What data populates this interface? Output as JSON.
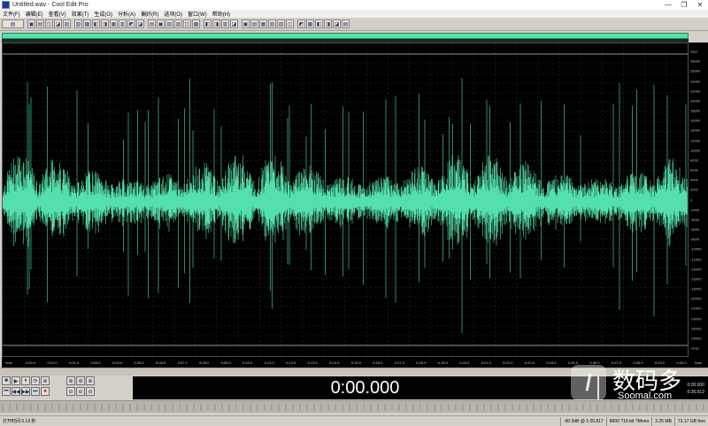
{
  "window": {
    "title": "Untitled.wav - Cool Edit Pro",
    "minimize_glyph": "—",
    "maximize_glyph": "❐",
    "close_glyph": "✕"
  },
  "menu": [
    "文件(F)",
    "编辑(E)",
    "查看(V)",
    "效果(T)",
    "生成(G)",
    "分析(A)",
    "偏好(R)",
    "选项(O)",
    "窗口(W)",
    "帮助(H)"
  ],
  "toolbar": {
    "buttons": [
      "▤",
      "▣",
      "▤",
      "◫",
      "◪",
      "▧",
      "▨",
      "▩",
      "◧",
      "◨",
      "▦",
      "▥",
      "◩",
      "◪",
      "▤",
      "▣",
      "▧",
      "▨",
      "◫",
      "▩",
      "◧",
      "◨",
      "▥",
      "◪",
      "▣",
      "▤",
      "▦",
      "▧",
      "▨",
      "◫",
      "◩",
      "▩",
      "◧",
      "◨",
      "◪",
      "▤"
    ]
  },
  "waveform": {
    "color": "#54e0aa",
    "background": "#000000",
    "grid_color": "#1f3a2c"
  },
  "y_axis": {
    "labels": [
      "smpl",
      "28000",
      "26000",
      "24000",
      "22000",
      "20000",
      "18000",
      "16000",
      "14000",
      "12000",
      "10000",
      "8000",
      "6000",
      "4000",
      "2000",
      "0",
      "-2000",
      "-4000",
      "-6000",
      "-8000",
      "-10000",
      "-12000",
      "-14000",
      "-16000",
      "-18000",
      "-20000",
      "-22000",
      "-24000",
      "-26000",
      "-28000",
      "-smpl"
    ]
  },
  "timeline": {
    "labels": [
      "hms",
      "0:00.0",
      "0:01.0",
      "0:02.0",
      "0:03.0",
      "0:04.0",
      "0:05.0",
      "0:06.0",
      "0:07.0",
      "0:08.0",
      "0:09.0",
      "0:10.0",
      "0:11.0",
      "0:12.0",
      "0:13.0",
      "0:14.0",
      "0:15.0",
      "0:16.0",
      "0:17.0",
      "0:18.0",
      "0:19.0",
      "0:20.0",
      "0:21.0",
      "0:22.0",
      "0:23.0",
      "0:24.0",
      "0:25.0",
      "0:26.0",
      "0:27.0",
      "0:28.0",
      "0:29.0",
      "0:30.0"
    ],
    "unit": "hms"
  },
  "transport": {
    "row1": [
      "■",
      "▶",
      "⏸",
      "⟳",
      "⊕"
    ],
    "row2": [
      "⏮",
      "◀◀",
      "▶▶",
      "⏭",
      "●"
    ],
    "zoom_row1": [
      "⊕",
      "⊕",
      "⊕"
    ],
    "zoom_row2": [
      "⊖",
      "⊖",
      "⊖"
    ]
  },
  "time_display": "0:00.000",
  "selection": {
    "line1": "0:00.000",
    "line2": "0:26.512"
  },
  "watermark": {
    "cn": "数码多",
    "en": "Soomal.com"
  },
  "status": {
    "left": "打开时间 0.13 秒",
    "cells": [
      "-90.3dB @ 1:25.817",
      "8000 ?16-bit ?Mono",
      "3.25 MB",
      "73.17 GB free"
    ]
  }
}
